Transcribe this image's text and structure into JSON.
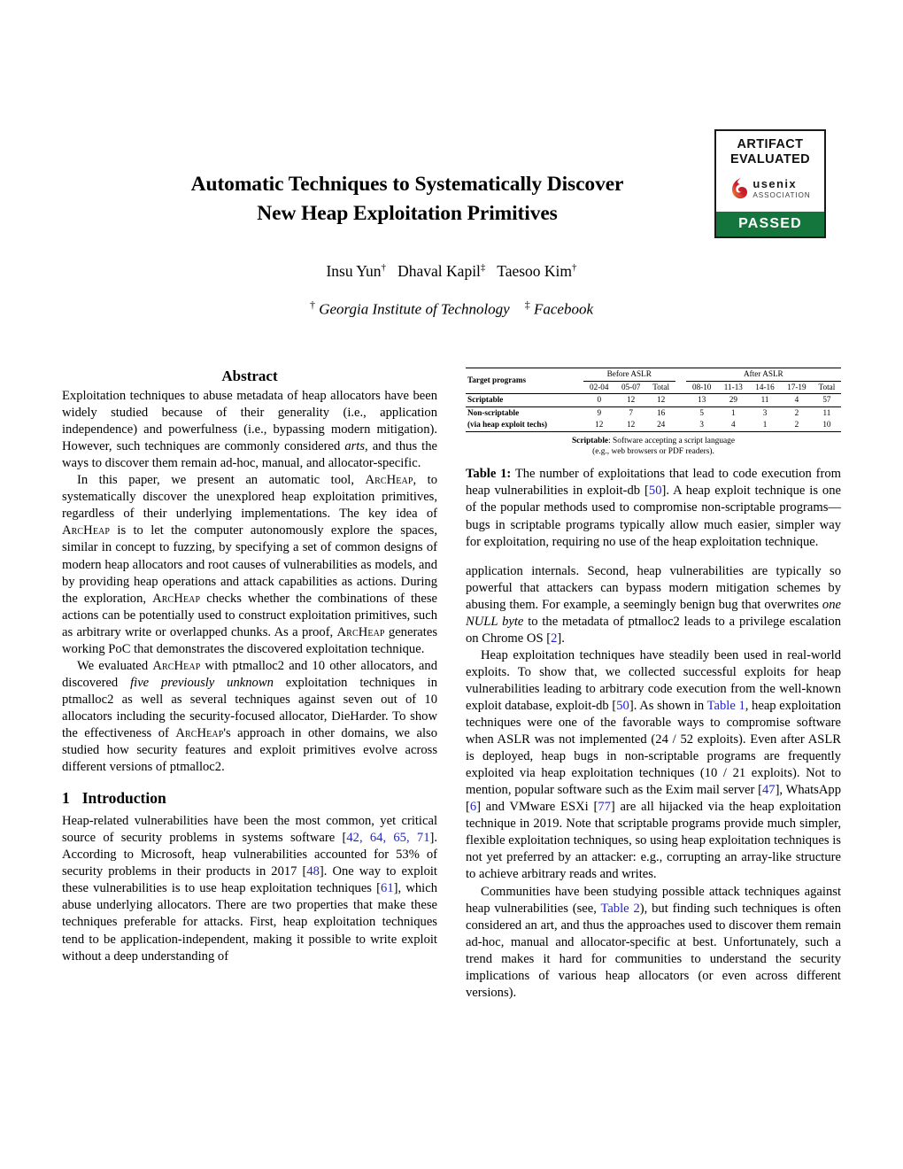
{
  "badge": {
    "line1": "ARTIFACT",
    "line2": "EVALUATED",
    "org_name": "usenix",
    "org_sub": "ASSOCIATION",
    "status": "PASSED"
  },
  "paper": {
    "title_line1": "Automatic Techniques to Systematically Discover",
    "title_line2": "New Heap Exploitation Primitives",
    "authors": "Insu Yun†  Dhaval Kapil‡  Taesoo Kim†",
    "author_list": [
      {
        "name": "Insu Yun",
        "mark": "†"
      },
      {
        "name": "Dhaval Kapil",
        "mark": "‡"
      },
      {
        "name": "Taesoo Kim",
        "mark": "†"
      }
    ],
    "affiliations": [
      {
        "mark": "†",
        "name": "Georgia Institute of Technology"
      },
      {
        "mark": "‡",
        "name": "Facebook"
      }
    ]
  },
  "abstract": {
    "heading": "Abstract",
    "p1": "Exploitation techniques to abuse metadata of heap allocators have been widely studied because of their generality (i.e., application independence) and powerfulness (i.e., bypassing modern mitigation). However, such techniques are commonly considered arts, and thus the ways to discover them remain ad-hoc, manual, and allocator-specific.",
    "p2": "In this paper, we present an automatic tool, ARCHEAP, to systematically discover the unexplored heap exploitation primitives, regardless of their underlying implementations. The key idea of ARCHEAP is to let the computer autonomously explore the spaces, similar in concept to fuzzing, by specifying a set of common designs of modern heap allocators and root causes of vulnerabilities as models, and by providing heap operations and attack capabilities as actions. During the exploration, ARCHEAP checks whether the combinations of these actions can be potentially used to construct exploitation primitives, such as arbitrary write or overlapped chunks. As a proof, ARCHEAP generates working PoC that demonstrates the discovered exploitation technique.",
    "p3": "We evaluated ARCHEAP with ptmalloc2 and 10 other allocators, and discovered five previously unknown exploitation techniques in ptmalloc2 as well as several techniques against seven out of 10 allocators including the security-focused allocator, DieHarder. To show the effectiveness of ARCHEAP's approach in other domains, we also studied how security features and exploit primitives evolve across different versions of ptmalloc2."
  },
  "introduction": {
    "number": "1",
    "heading": "Introduction",
    "p1_a": "Heap-related vulnerabilities have been the most common, yet critical source of security problems in systems software [",
    "p1_refs1": "42, 64, 65, 71",
    "p1_b": "]. According to Microsoft, heap vulnerabilities accounted for 53% of security problems in their products in 2017 [",
    "p1_ref2": "48",
    "p1_c": "]. One way to exploit these vulnerabilities is to use heap exploitation techniques [",
    "p1_ref3": "61",
    "p1_d": "], which abuse underlying allocators. There are two properties that make these techniques preferable for attacks. First, heap exploitation techniques tend to be application-independent, making it possible to write exploit without a deep understanding of application internals. Second, heap vulnerabilities are typically so powerful that attackers can bypass modern mitigation schemes by abusing them. For example, a seemingly benign bug that overwrites ",
    "p1_em": "one NULL byte",
    "p1_e": " to the metadata of ptmalloc2 leads to a privilege escalation on Chrome OS [",
    "p1_ref4": "2",
    "p1_f": "].",
    "p2_a": "Heap exploitation techniques have steadily been used in real-world exploits. To show that, we collected successful exploits for heap vulnerabilities leading to arbitrary code execution from the well-known exploit database, exploit-db [",
    "p2_ref1": "50",
    "p2_b": "]. As shown in ",
    "p2_link1": "Table 1",
    "p2_c": ", heap exploitation techniques were one of the favorable ways to compromise software when ASLR was not implemented (24 / 52 exploits). Even after ASLR is deployed, heap bugs in non-scriptable programs are frequently exploited via heap exploitation techniques (10 / 21 exploits). Not to mention, popular software such as the Exim mail server [",
    "p2_ref2": "47",
    "p2_d": "], WhatsApp [",
    "p2_ref3": "6",
    "p2_e": "] and VMware ESXi [",
    "p2_ref4": "77",
    "p2_f": "] are all hijacked via the heap exploitation technique in 2019. Note that scriptable programs provide much simpler, flexible exploitation techniques, so using heap exploitation techniques is not yet preferred by an attacker: e.g., corrupting an array-like structure to achieve arbitrary reads and writes.",
    "p3_a": "Communities have been studying possible attack techniques against heap vulnerabilities (see, ",
    "p3_link1": "Table 2",
    "p3_b": "), but finding such techniques is often considered an art, and thus the approaches used to discover them remain ad-hoc, manual and allocator-specific at best. Unfortunately, such a trend makes it hard for communities to understand the security implications of various heap allocators (or even across different versions)."
  },
  "table1": {
    "corner_header": "Target programs",
    "group_headers": [
      {
        "label": "Before ASLR",
        "span": 3
      },
      {
        "label": "After ASLR",
        "span": 5
      }
    ],
    "column_headers": [
      "02-04",
      "05-07",
      "Total",
      "08-10",
      "11-13",
      "14-16",
      "17-19",
      "Total"
    ],
    "rows": [
      {
        "label": "Scriptable",
        "label_sub": "",
        "values": [
          "0",
          "12",
          "12",
          "13",
          "29",
          "11",
          "4",
          "57"
        ]
      },
      {
        "label": "Non-scriptable",
        "label_sub": "(via heap exploit techs)",
        "values_line1": [
          "9",
          "7",
          "16",
          "5",
          "1",
          "3",
          "2",
          "11"
        ],
        "values_line2": [
          "12",
          "12",
          "24",
          "3",
          "4",
          "1",
          "2",
          "10"
        ]
      }
    ],
    "note_bold": "Scriptable",
    "note_rest": ": Software accepting a script language",
    "note_line2": "(e.g., web browsers or PDF readers).",
    "caption_label": "Table 1:",
    "caption_a": " The number of exploitations that lead to code execution from heap vulnerabilities in exploit-db [",
    "caption_ref": "50",
    "caption_b": "]. A heap exploit technique is one of the popular methods used to compromise non-scriptable programs—bugs in scriptable programs typically allow much easier, simpler way for exploitation, requiring no use of the heap exploitation technique."
  },
  "colors": {
    "link": "#2222cc",
    "badge_green": "#14763c",
    "text": "#000000"
  }
}
